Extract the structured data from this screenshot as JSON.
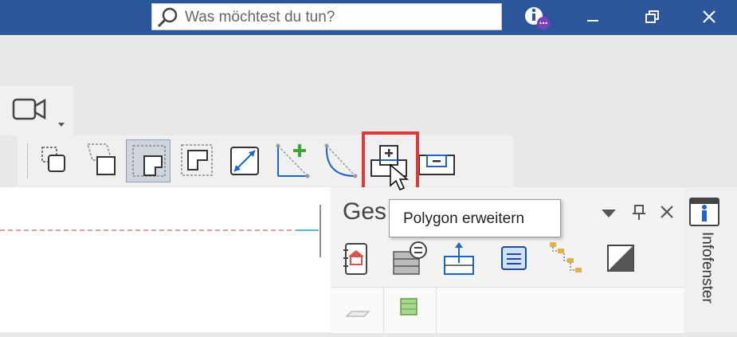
{
  "titlebar": {
    "search_placeholder": "Was möchtest du tun?",
    "info_icon": "info-user-icon",
    "minimize_icon": "minimize-icon",
    "restore_icon": "restore-icon",
    "close_icon": "close-icon"
  },
  "ribbon": {
    "camera_icon": "camera-icon",
    "tools": [
      {
        "name": "copy-selection-icon"
      },
      {
        "name": "transform-shape-icon"
      },
      {
        "name": "polygon-corner-icon",
        "selected": true
      },
      {
        "name": "polygon-dashed-icon"
      },
      {
        "name": "diagonal-split-icon"
      },
      {
        "name": "add-line-point-icon"
      },
      {
        "name": "arc-curve-icon"
      },
      {
        "name": "polygon-expand-icon",
        "highlighted": true
      },
      {
        "name": "polygon-reduce-icon"
      }
    ]
  },
  "tooltip": {
    "text": "Polygon erweitern"
  },
  "panel": {
    "title": "Ges",
    "dropdown_icon": "dropdown-triangle-icon",
    "pin_icon": "pin-icon",
    "close_icon": "close-icon",
    "buttons": [
      "house-notebook-icon",
      "layer-settings-icon",
      "3d-box-icon",
      "list-view-icon",
      "tree-icon",
      "contrast-icon"
    ],
    "sub_cells": [
      "plane-icon",
      "cube-icon"
    ]
  },
  "infofenster": {
    "label": "Infofenster",
    "icon": "info-window-icon"
  },
  "colors": {
    "titlebar": "#2b579a",
    "highlight": "#e0393b"
  }
}
